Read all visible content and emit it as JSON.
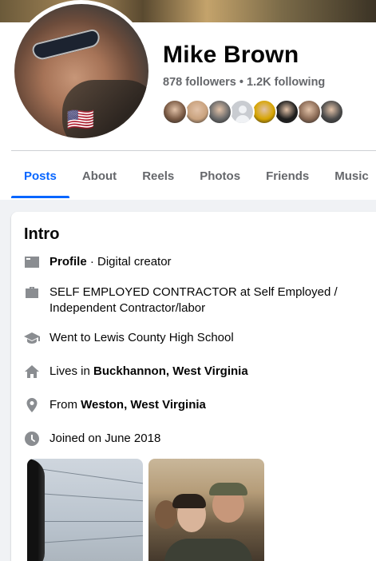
{
  "profile": {
    "name": "Mike Brown",
    "stats": "878 followers • 1.2K following",
    "flag": "🇺🇸"
  },
  "friend_avatars": [
    {
      "color": "#7a5a44"
    },
    {
      "color": "#c9a27e"
    },
    {
      "color": "#6a6a6a"
    },
    {
      "color": "placeholder"
    },
    {
      "color": "#d6a400"
    },
    {
      "color": "#1e1e1e"
    },
    {
      "color": "#8a6a55"
    },
    {
      "color": "#4a4a4a"
    }
  ],
  "tabs": [
    {
      "label": "Posts",
      "active": true
    },
    {
      "label": "About"
    },
    {
      "label": "Reels"
    },
    {
      "label": "Photos"
    },
    {
      "label": "Friends"
    },
    {
      "label": "Music"
    }
  ],
  "intro": {
    "title": "Intro",
    "profile_label": "Profile",
    "profile_rest": " · Digital creator",
    "work": "SELF EMPLOYED CONTRACTOR at Self Employed / Independent Contractor/labor",
    "school": "Went to Lewis County High School",
    "lives_prefix": "Lives in ",
    "lives_place": "Buckhannon, West Virginia",
    "from_prefix": "From ",
    "from_place": "Weston, West Virginia",
    "joined": "Joined on June 2018"
  },
  "colors": {
    "accent": "#0866ff",
    "muted_text": "#65676b",
    "icon": "#8a8d91",
    "background": "#f0f2f5"
  }
}
